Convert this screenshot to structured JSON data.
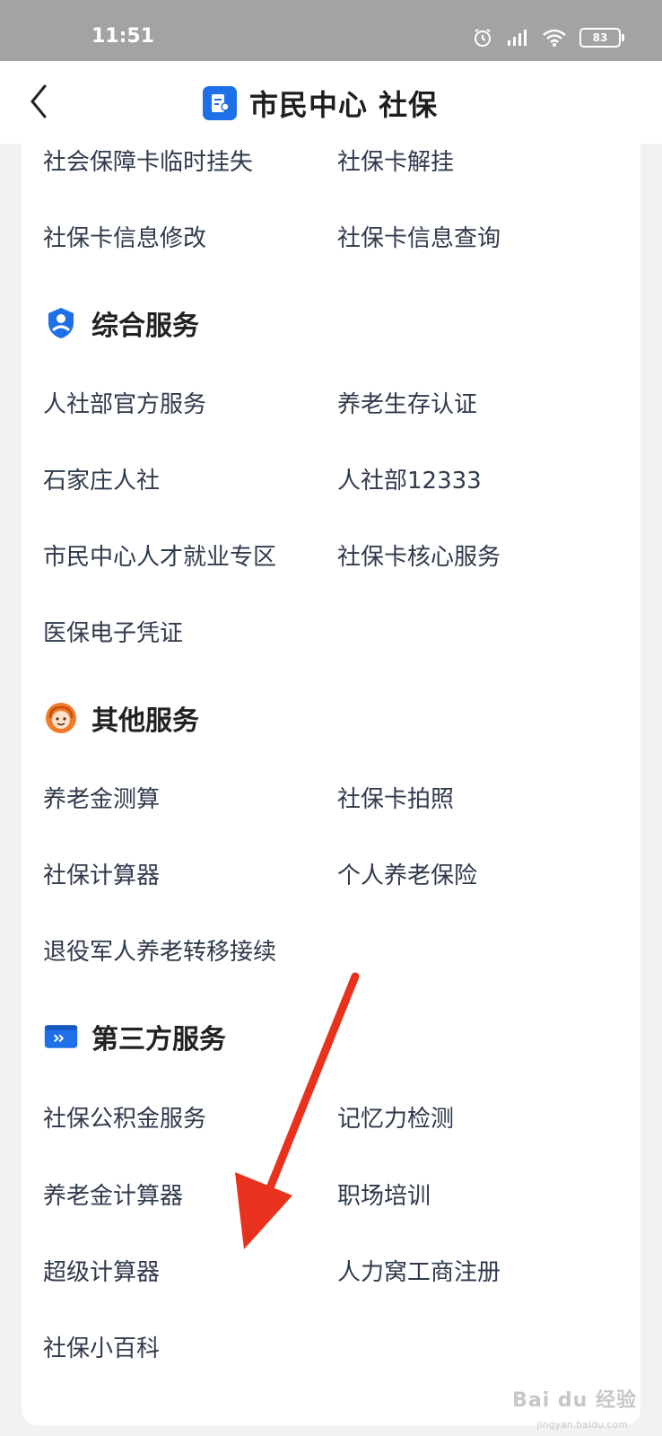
{
  "status_bar": {
    "time": "11:51",
    "battery": "83"
  },
  "header": {
    "title": "市民中心  社保"
  },
  "rows_top": [
    {
      "left": "社会保障卡临时挂失",
      "right": "社保卡解挂"
    },
    {
      "left": "社保卡信息修改",
      "right": "社保卡信息查询"
    }
  ],
  "sections": [
    {
      "title": "综合服务",
      "icon": "person-shield-icon",
      "rows": [
        {
          "left": "人社部官方服务",
          "right": "养老生存认证"
        },
        {
          "left": "石家庄人社",
          "right": "人社部12333"
        },
        {
          "left": "市民中心人才就业专区",
          "right": "社保卡核心服务"
        },
        {
          "left": "医保电子凭证",
          "right": ""
        }
      ]
    },
    {
      "title": "其他服务",
      "icon": "customer-service-icon",
      "rows": [
        {
          "left": "养老金测算",
          "right": "社保卡拍照"
        },
        {
          "left": "社保计算器",
          "right": "个人养老保险"
        },
        {
          "left": "退役军人养老转移接续",
          "right": ""
        }
      ]
    },
    {
      "title": "第三方服务",
      "icon": "forward-card-icon",
      "rows": [
        {
          "left": "社保公积金服务",
          "right": "记忆力检测"
        },
        {
          "left": "养老金计算器",
          "right": "职场培训"
        },
        {
          "left": "超级计算器",
          "right": "人力窝工商注册"
        },
        {
          "left": "社保小百科",
          "right": ""
        }
      ]
    }
  ],
  "watermark": {
    "brand": "Bai du 经验",
    "url": "jingyan.baidu.com"
  },
  "colors": {
    "accent": "#1e70e8",
    "arrow": "#e8321e",
    "status_bar": "#a3a3a3"
  }
}
